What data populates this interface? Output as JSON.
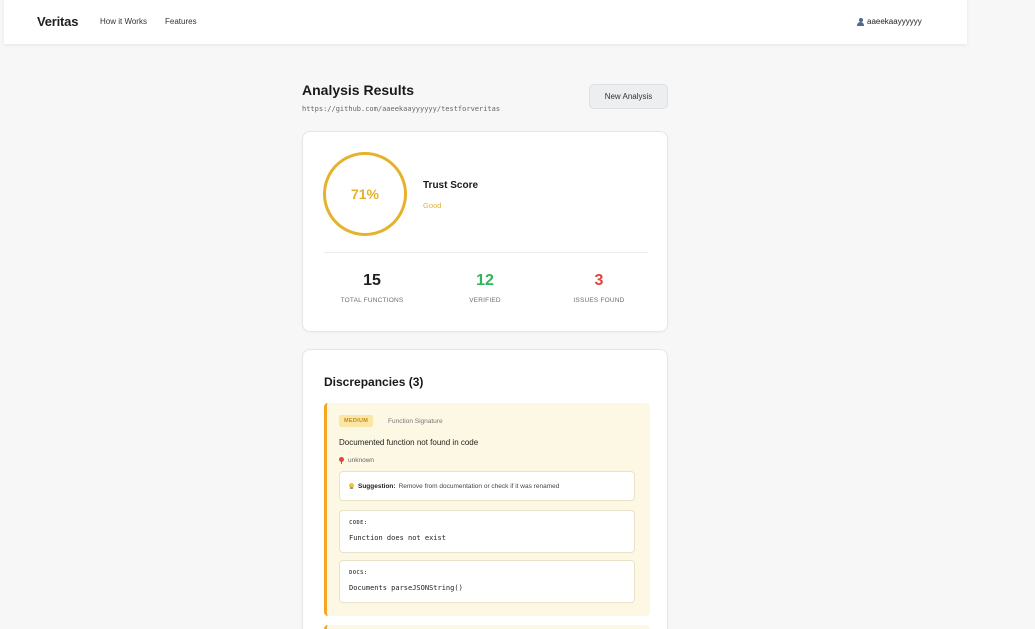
{
  "nav": {
    "brand": "Veritas",
    "links": [
      "How it Works",
      "Features"
    ],
    "username": "aaeekaayyyyyy"
  },
  "header": {
    "title": "Analysis Results",
    "repo_url": "https://github.com/aaeekaayyyyyy/testforveritas",
    "new_analysis_label": "New Analysis"
  },
  "score": {
    "value_text": "71%",
    "value": 0.71,
    "label": "Trust Score",
    "status": "Good",
    "accent_color": "#e5b22c"
  },
  "stats": [
    {
      "value": "15",
      "label": "TOTAL FUNCTIONS",
      "color": "#1f1f1f"
    },
    {
      "value": "12",
      "label": "VERIFIED",
      "color": "#2fb45a"
    },
    {
      "value": "3",
      "label": "ISSUES FOUND",
      "color": "#e0453a"
    }
  ],
  "discrepancies": {
    "title": "Discrepancies (3)",
    "items": [
      {
        "severity": "MEDIUM",
        "category": "Function Signature",
        "message": "Documented function not found in code",
        "location": "unknown",
        "suggestion_label": "Suggestion:",
        "suggestion": "Remove from documentation or check if it was renamed",
        "code_label": "CODE:",
        "code": "Function does not exist",
        "docs_label": "DOCS:",
        "docs": "Documents parseJSONString()"
      }
    ]
  },
  "icons": {
    "user": "user-icon",
    "location": "pin-icon",
    "suggestion": "lightbulb-icon"
  }
}
